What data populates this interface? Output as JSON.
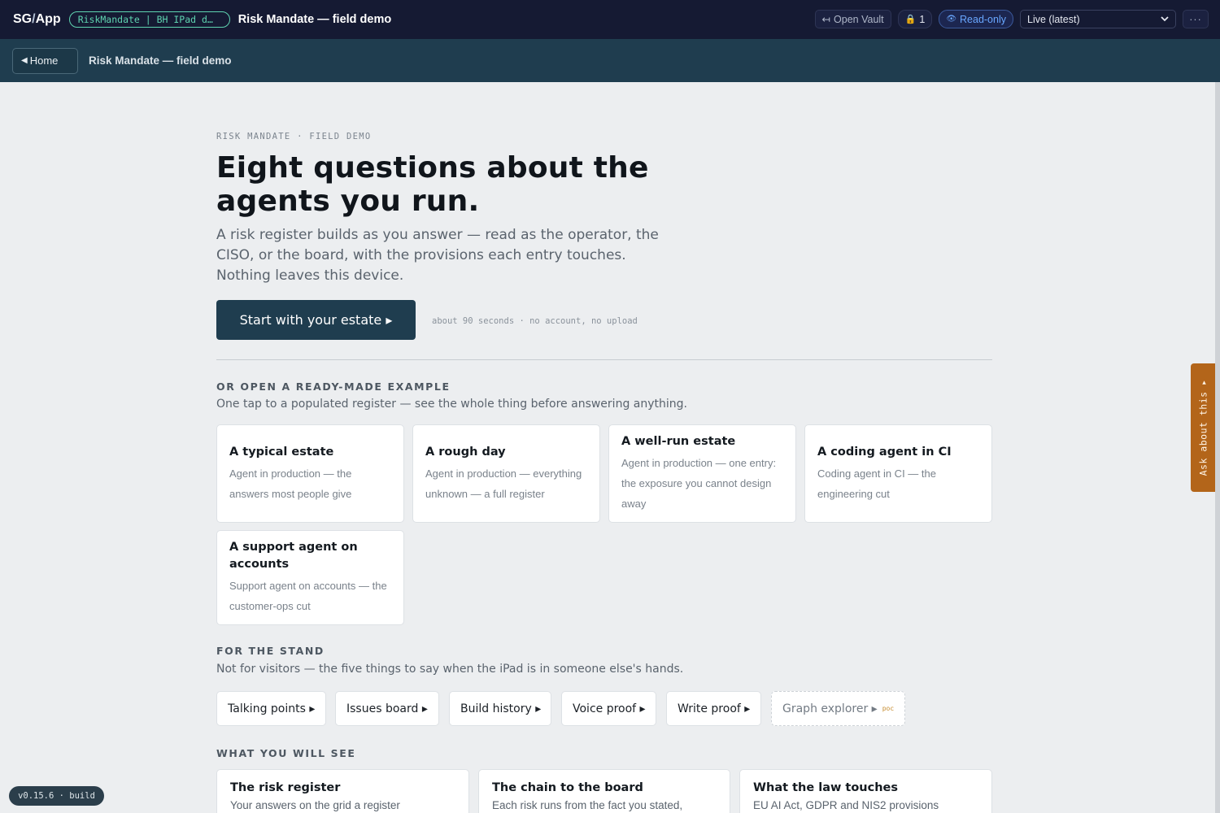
{
  "topbar": {
    "brand_left": "SG",
    "brand_slash": "/",
    "brand_right": "App",
    "context_pill": "RiskMandate | BH IPad d…",
    "title": "Risk Mandate — field demo",
    "open_vault_icon": "↤",
    "open_vault_label": "Open Vault",
    "lock_icon": "🔒",
    "lock_count": "1",
    "readonly_icon": "👁",
    "readonly_label": "Read-only",
    "version_select": "Live (latest)",
    "more_label": "···"
  },
  "subbar": {
    "home_icon": "◀",
    "home_label": "Home",
    "title": "Risk Mandate — field demo"
  },
  "hero": {
    "eyebrow": "RISK MANDATE · FIELD DEMO",
    "title": "Eight questions about the agents you run.",
    "lede": "A risk register builds as you answer — read as the operator, the CISO, or the board, with the provisions each entry touches. Nothing leaves this device.",
    "cta_label": "Start with your estate ▸",
    "cta_note": "about 90 seconds · no account, no upload"
  },
  "examples": {
    "heading": "OR OPEN A READY-MADE EXAMPLE",
    "subheading": "One tap to a populated register — see the whole thing before answering anything.",
    "cards": [
      {
        "title": "A typical estate",
        "desc": "Agent in production — the answers most people give"
      },
      {
        "title": "A rough day",
        "desc": "Agent in production — everything unknown — a full register"
      },
      {
        "title": "A well-run estate",
        "desc": "Agent in production — one entry: the exposure you cannot design away"
      },
      {
        "title": "A coding agent in CI",
        "desc": "Coding agent in CI — the engineering cut"
      },
      {
        "title": "A support agent on accounts",
        "desc": "Support agent on accounts — the customer-ops cut"
      }
    ]
  },
  "stand": {
    "heading": "FOR THE STAND",
    "subheading": "Not for visitors — the five things to say when the iPad is in someone else's hands.",
    "buttons": [
      {
        "label": "Talking points ▸"
      },
      {
        "label": "Issues board ▸"
      },
      {
        "label": "Build history ▸"
      },
      {
        "label": "Voice proof ▸"
      },
      {
        "label": "Write proof ▸"
      },
      {
        "label": "Graph explorer ▸",
        "tag": "poc"
      }
    ]
  },
  "see": {
    "heading": "WHAT YOU WILL SEE",
    "cards": [
      {
        "title": "The risk register",
        "desc": "Your answers on the grid a register"
      },
      {
        "title": "The chain to the board",
        "desc": "Each risk runs from the fact you stated,"
      },
      {
        "title": "What the law touches",
        "desc": "EU AI Act, GDPR and NIS2 provisions"
      }
    ]
  },
  "ask_tab": {
    "label": "Ask about this ▸"
  },
  "version_badge": "v0.15.6 · build",
  "colors": {
    "topbar_bg": "#151a33",
    "subbar_bg": "#1f3d4f",
    "accent_teal": "#5fd3b0",
    "readonly_blue": "#69a7ff",
    "ask_tab_orange": "#b3651a",
    "cta_bg": "#1f3d4f",
    "page_bg": "#eceef0"
  }
}
